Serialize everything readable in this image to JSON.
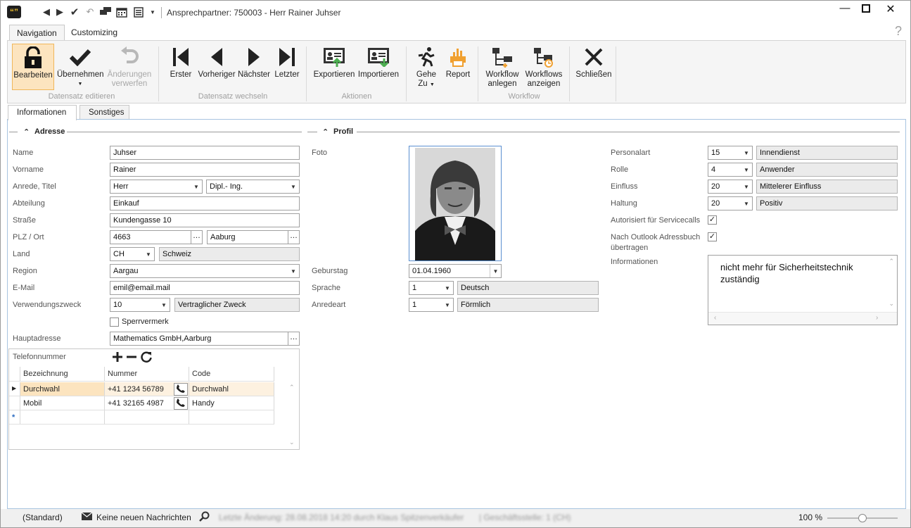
{
  "window": {
    "title": "Ansprechpartner: 750003 - Herr Rainer Juhser",
    "app_icon_text": "“”"
  },
  "titlebar_icons": [
    "back-icon",
    "forward-icon",
    "check-icon",
    "undo-icon",
    "chat-icon",
    "calendar-icon",
    "list-icon",
    "dropdown-icon"
  ],
  "ribbon_tabs": [
    {
      "label": "Navigation"
    },
    {
      "label": "Customizing"
    }
  ],
  "ribbon": {
    "buttons": {
      "edit": "Bearbeiten",
      "accept": "Übernehmen",
      "discard1": "Änderungen",
      "discard2": "verwerfen",
      "first": "Erster",
      "previous": "Vorheriger",
      "next": "Nächster",
      "last": "Letzter",
      "export": "Exportieren",
      "import": "Importieren",
      "goto1": "Gehe",
      "goto2": "Zu",
      "report": "Report",
      "wf_create1": "Workflow",
      "wf_create2": "anlegen",
      "wf_show1": "Workflows",
      "wf_show2": "anzeigen",
      "close": "Schließen"
    },
    "groups": {
      "record_edit": "Datensatz editieren",
      "record_switch": "Datensatz wechseln",
      "actions": "Aktionen",
      "workflow": "Workflow"
    }
  },
  "content_tabs": [
    {
      "label": "Informationen"
    },
    {
      "label": "Sonstiges"
    }
  ],
  "address": {
    "heading": "Adresse",
    "labels": {
      "name": "Name",
      "vorname": "Vorname",
      "anrede": "Anrede, Titel",
      "abteilung": "Abteilung",
      "strasse": "Straße",
      "plz": "PLZ / Ort",
      "land": "Land",
      "region": "Region",
      "email": "E-Mail",
      "zweck": "Verwendungszweck",
      "haupt": "Hauptadresse",
      "telefon": "Telefonnummer"
    },
    "values": {
      "name": "Juhser",
      "vorname": "Rainer",
      "anrede": "Herr",
      "titel": "Dipl.- Ing.",
      "abteilung": "Einkauf",
      "strasse": "Kundengasse 10",
      "plz": "4663",
      "ort": "Aaburg",
      "land_code": "CH",
      "land": "Schweiz",
      "region": "Aargau",
      "email": "emil@email.mail",
      "zweck_code": "10",
      "zweck": "Vertraglicher Zweck",
      "sperr": "Sperrvermerk",
      "haupt": "Mathematics GmbH,Aarburg"
    }
  },
  "phones": {
    "columns": [
      "Bezeichnung",
      "Nummer",
      "Code"
    ],
    "rows": [
      {
        "bez": "Durchwahl",
        "nr": "+41 1234 56789",
        "code": "Durchwahl"
      },
      {
        "bez": "Mobil",
        "nr": "+41 32165 4987",
        "code": "Handy"
      }
    ],
    "new_row_marker": "*"
  },
  "profile": {
    "heading": "Profil",
    "labels": {
      "foto": "Foto",
      "geburtstag": "Geburstag",
      "sprache": "Sprache",
      "anredeart": "Anredeart"
    },
    "values": {
      "geburtstag": "01.04.1960",
      "sprache_code": "1",
      "sprache": "Deutsch",
      "anredeart_code": "1",
      "anredeart": "Förmlich"
    }
  },
  "right": {
    "labels": {
      "personalart": "Personalart",
      "rolle": "Rolle",
      "einfluss": "Einfluss",
      "haltung": "Haltung",
      "autorisiert": "Autorisiert für Servicecalls",
      "outlook1": "Nach Outlook Adressbuch",
      "outlook2": "übertragen",
      "info": "Informationen"
    },
    "values": {
      "personalart_code": "15",
      "personalart": "Innendienst",
      "rolle_code": "4",
      "rolle": "Anwender",
      "einfluss_code": "20",
      "einfluss": "Mittelerer Einfluss",
      "haltung_code": "20",
      "haltung": "Positiv",
      "info_line1": "nicht mehr für Sicherheitstechnik",
      "info_line2": "zuständig"
    },
    "checked": {
      "autorisiert": true,
      "outlook": true
    }
  },
  "statusbar": {
    "standard": "(Standard)",
    "messages": "Keine neuen Nachrichten",
    "last_change": "Letzte Änderung: 28.08.2018 14:20 durch Klaus Spitzenverkäufer",
    "office": "| Geschäftsstelle: 1 (CH)",
    "zoom": "100 %"
  },
  "colors": {
    "accent": "#f0b75a",
    "active_bg": "#fce4bf",
    "icon_orange": "#f0a030",
    "icon_green": "#4caf50",
    "border_blue": "#a8c4e0"
  }
}
